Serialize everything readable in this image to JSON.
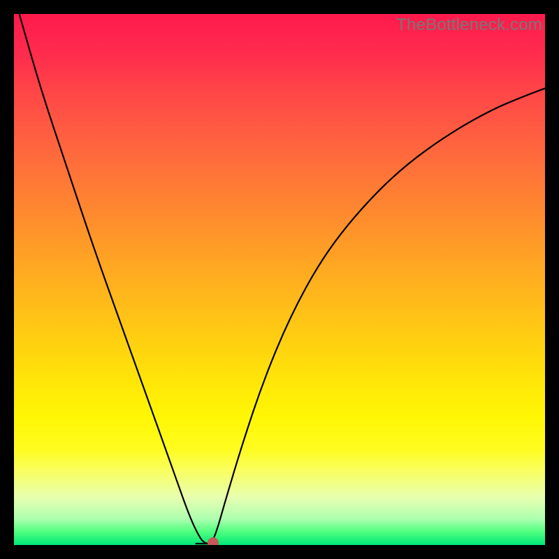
{
  "watermark": "TheBottleneck.com",
  "chart_data": {
    "type": "line",
    "title": "",
    "xlabel": "",
    "ylabel": "",
    "xlim": [
      0,
      100
    ],
    "ylim": [
      0,
      100
    ],
    "grid": false,
    "legend": false,
    "notch": {
      "x_pct": 36.0,
      "y_pct": 0.0
    },
    "marker": {
      "x_pct": 37.5,
      "y_pct": 0.0,
      "color": "#c85858",
      "radius_px": 8
    },
    "series": [
      {
        "name": "curve",
        "x_pct": [
          1,
          5,
          10,
          15,
          20,
          25,
          30,
          33,
          35,
          36,
          37,
          38,
          40,
          43,
          47,
          52,
          58,
          65,
          73,
          82,
          90,
          96,
          100
        ],
        "y_pct": [
          100,
          86,
          71,
          56,
          42,
          28,
          14,
          5.5,
          1.3,
          0.3,
          0.25,
          2,
          9,
          19,
          31,
          43,
          54,
          63,
          71,
          77.5,
          82,
          84.5,
          86
        ]
      }
    ]
  }
}
